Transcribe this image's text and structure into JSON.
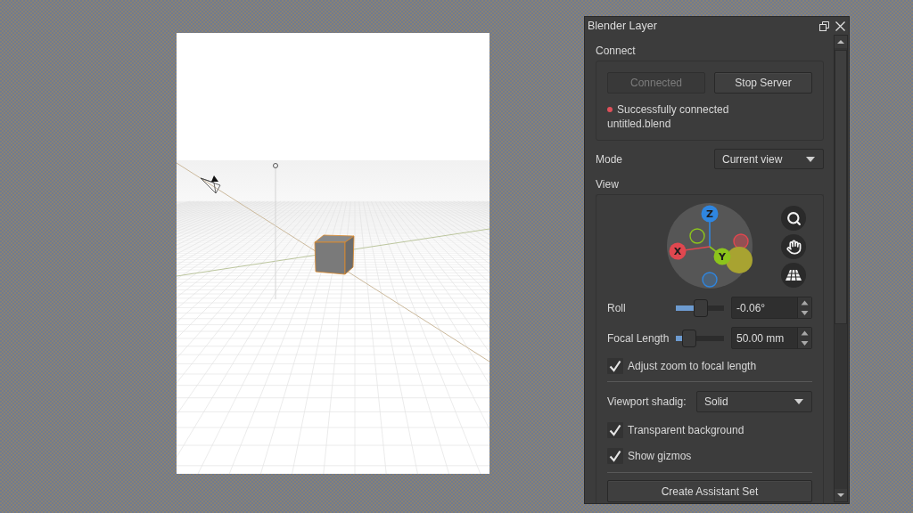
{
  "window": {
    "title": "Blender Layer"
  },
  "connect": {
    "label": "Connect",
    "buttons": [
      {
        "label": "Connected",
        "disabled": true
      },
      {
        "label": "Stop Server",
        "disabled": false
      }
    ],
    "status": "Successfully connected",
    "file": "untitled.blend"
  },
  "mode": {
    "label": "Mode",
    "value": "Current view"
  },
  "view": {
    "label": "View",
    "gizmo": {
      "axes": [
        {
          "label": "Z",
          "color": "#2f86e0"
        },
        {
          "label": "X",
          "color": "#e0474f"
        },
        {
          "label": "Y",
          "color": "#8cc41c"
        }
      ]
    },
    "sliders": [
      {
        "label": "Roll",
        "level": 0.52,
        "value": "-0.06°"
      },
      {
        "label": "Focal Length",
        "level": 0.27,
        "value": "50.00 mm"
      }
    ],
    "zoom_option": {
      "label": "Adjust zoom to focal length",
      "checked": true
    },
    "shading": {
      "label": "Viewport shadig:",
      "value": "Solid"
    },
    "options": [
      {
        "label": "Transparent background",
        "checked": true
      },
      {
        "label": "Show gizmos",
        "checked": true
      }
    ],
    "create_button": {
      "label": "Create Assistant Set"
    }
  }
}
